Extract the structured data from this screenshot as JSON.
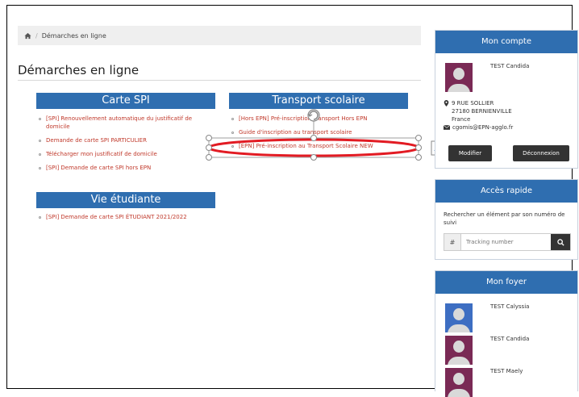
{
  "breadcrumb": {
    "current": "Démarches en ligne"
  },
  "page": {
    "title": "Démarches en ligne"
  },
  "sections": {
    "carte_spi": {
      "title": "Carte SPI",
      "items": [
        "[SPI] Renouvellement automatique du justificatif de domicile",
        "Demande de carte SPI PARTICULIER",
        "Télécharger mon justificatif de domicile",
        "[SPI] Demande de carte SPI hors EPN"
      ]
    },
    "transport": {
      "title": "Transport scolaire",
      "items": [
        "[Hors EPN] Pré-inscription Transport Hors EPN",
        "Guide d'inscription au transport scolaire",
        "[EPN] Pré-inscription au Transport Scolaire NEW"
      ]
    },
    "vie": {
      "title": "Vie étudiante",
      "items": [
        "[SPI] Demande de carte SPI ÉTUDIANT 2021/2022"
      ]
    }
  },
  "account": {
    "title": "Mon compte",
    "name": "TEST Candida",
    "address_line1": "9 RUE SOLLIER",
    "address_line2": "27180 BERNIENVILLE",
    "country": "France",
    "email": "cgomis@EPN-agglo.fr",
    "edit_label": "Modifier",
    "logout_label": "Déconnexion"
  },
  "quick_access": {
    "title": "Accès rapide",
    "description": "Rechercher un élément par son numéro de suivi",
    "hash": "#",
    "placeholder": "Tracking number"
  },
  "household": {
    "title": "Mon foyer",
    "members": [
      {
        "name": "TEST Calyssia",
        "color": "#3d6ec2"
      },
      {
        "name": "TEST Candida",
        "color": "#7a2a55"
      },
      {
        "name": "TEST Maely",
        "color": "#7a2a55"
      }
    ]
  },
  "colors": {
    "accent": "#2f6eb0",
    "link": "#c0392b",
    "highlight": "#e21b23"
  }
}
